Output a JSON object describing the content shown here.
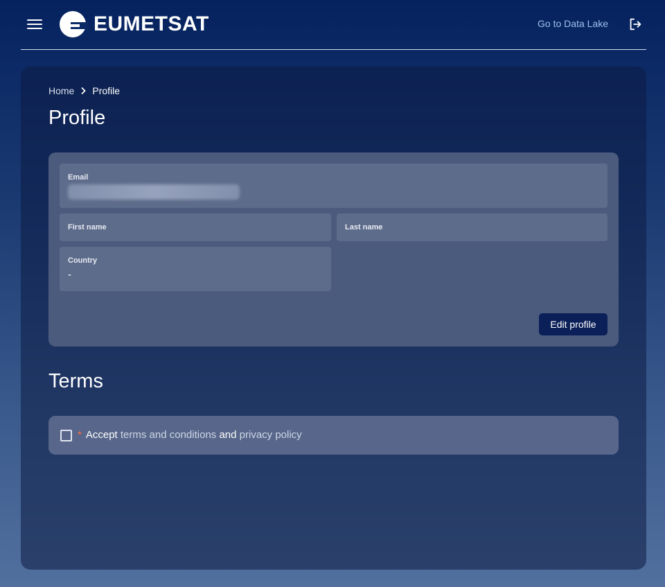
{
  "header": {
    "brand": "EUMETSAT",
    "datalake_label": "Go to Data Lake"
  },
  "breadcrumb": {
    "home": "Home",
    "current": "Profile"
  },
  "page": {
    "title": "Profile"
  },
  "profile": {
    "email_label": "Email",
    "first_name_label": "First name",
    "first_name_value": "",
    "last_name_label": "Last name",
    "last_name_value": "",
    "country_label": "Country",
    "country_value": "-",
    "edit_label": "Edit profile"
  },
  "terms": {
    "title": "Terms",
    "required_mark": "*",
    "accept": "Accept",
    "terms_link": "terms and conditions",
    "and": "and",
    "privacy_link": "privacy policy"
  },
  "icons": {
    "menu": "menu-icon",
    "logout": "logout-icon",
    "chevron": "chevron-right-icon"
  },
  "colors": {
    "accent_button": "#0b2058",
    "link": "#9cc2ee",
    "required": "#ff6a3a"
  }
}
